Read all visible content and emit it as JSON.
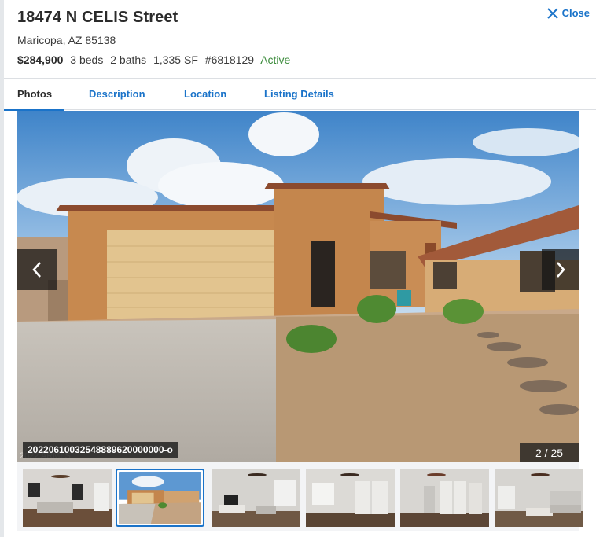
{
  "listing": {
    "address": "18474 N CELIS Street",
    "city_line": "Maricopa, AZ 85138",
    "price": "$284,900",
    "beds": "3 beds",
    "baths": "2 baths",
    "sqft": "1,335 SF",
    "mls": "#6818129",
    "status": "Active",
    "status_color": "#3b8b3b"
  },
  "close": {
    "label": "Close",
    "icon": "close-icon"
  },
  "tabs": [
    {
      "label": "Photos",
      "active": true
    },
    {
      "label": "Description",
      "active": false
    },
    {
      "label": "Location",
      "active": false
    },
    {
      "label": "Listing Details",
      "active": false
    }
  ],
  "gallery": {
    "caption": "20220610032548889620000000-o",
    "watermark": "2022 ARMLS",
    "counter": "2 / 25",
    "prev_icon": "chevron-left-icon",
    "next_icon": "chevron-right-icon",
    "selected_index": 1,
    "thumbnails": [
      {
        "label": "living-room"
      },
      {
        "label": "exterior-front"
      },
      {
        "label": "living-room-tv"
      },
      {
        "label": "bedroom"
      },
      {
        "label": "bedroom-closet"
      },
      {
        "label": "living-room-2"
      }
    ]
  },
  "colors": {
    "accent": "#1a73c9",
    "text": "#2b2b2b"
  }
}
